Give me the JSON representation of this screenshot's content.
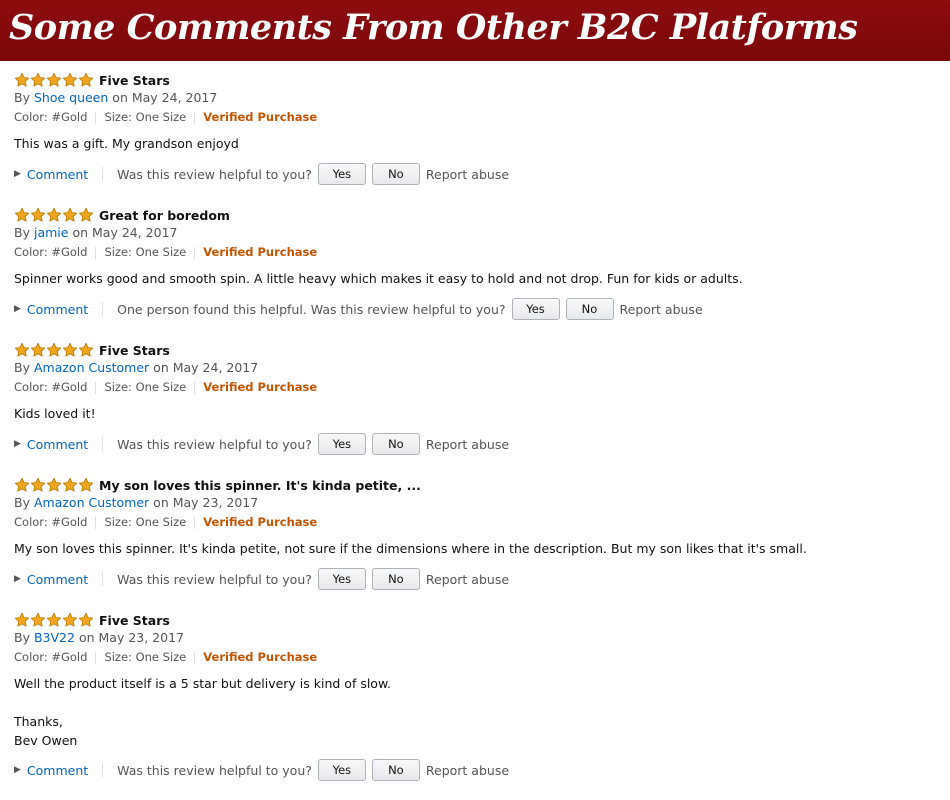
{
  "banner": {
    "title": "Some Comments From Other B2C Platforms"
  },
  "labels": {
    "by": "By",
    "on": "on",
    "comment": "Comment",
    "helpful_question": "Was this review helpful to you?",
    "yes": "Yes",
    "no": "No",
    "report": "Report abuse"
  },
  "rating": {
    "stars": 5,
    "max": 5,
    "color": "#f0a51c"
  },
  "colors": {
    "banner_bg": "#8e0d0f",
    "link": "#0066c0",
    "verified": "#c45500"
  },
  "reviews": [
    {
      "title": "Five Stars",
      "author": "Shoe queen",
      "date": "May 24, 2017",
      "color": "Color: #Gold",
      "size": "Size: One Size",
      "badge": "Verified Purchase",
      "body": "This was a gift. My grandson enjoyd",
      "helpful_count": ""
    },
    {
      "title": "Great for boredom",
      "author": "jamie",
      "date": "May 24, 2017",
      "color": "Color: #Gold",
      "size": "Size: One Size",
      "badge": "Verified Purchase",
      "body": "Spinner works good and smooth spin. A little heavy which makes it easy to hold and not drop. Fun for kids or adults.",
      "helpful_count": "One person found this helpful."
    },
    {
      "title": "Five Stars",
      "author": "Amazon Customer",
      "date": "May 24, 2017",
      "color": "Color: #Gold",
      "size": "Size: One Size",
      "badge": "Verified Purchase",
      "body": "Kids loved it!",
      "helpful_count": ""
    },
    {
      "title": "My son loves this spinner. It's kinda petite, ...",
      "author": "Amazon Customer",
      "date": "May 23, 2017",
      "color": "Color: #Gold",
      "size": "Size: One Size",
      "badge": "Verified Purchase",
      "body": "My son loves this spinner. It's kinda petite, not sure if the dimensions where in the description. But my son likes that it's small.",
      "helpful_count": ""
    },
    {
      "title": "Five Stars",
      "author": "B3V22",
      "date": "May 23, 2017",
      "color": "Color: #Gold",
      "size": "Size: One Size",
      "badge": "Verified Purchase",
      "body_lines": [
        "Well the product itself is a 5 star but delivery is kind of slow.",
        "",
        "Thanks,",
        "Bev Owen"
      ],
      "helpful_count": ""
    }
  ]
}
